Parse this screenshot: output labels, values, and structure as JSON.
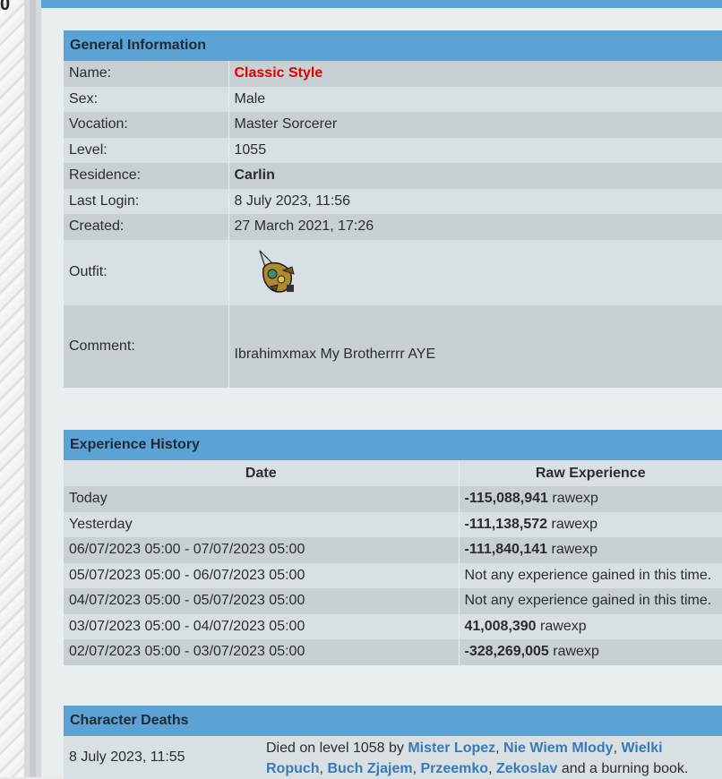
{
  "general": {
    "title": "General Information",
    "rows": [
      {
        "label": "Name:",
        "value": "Classic Style"
      },
      {
        "label": "Sex:",
        "value": "Male"
      },
      {
        "label": "Vocation:",
        "value": "Master Sorcerer"
      },
      {
        "label": "Level:",
        "value": "1055"
      },
      {
        "label": "Residence:",
        "value": "Carlin"
      },
      {
        "label": "Last Login:",
        "value": "8 July 2023, 11:56"
      },
      {
        "label": "Created:",
        "value": "27 March 2021, 17:26"
      }
    ],
    "outfit_label": "Outfit:",
    "comment_label": "Comment:",
    "comment_value": "Ibrahimxmax My Brotherrrr AYE"
  },
  "experience": {
    "title": "Experience History",
    "col_date": "Date",
    "col_exp": "Raw Experience",
    "rows": [
      {
        "date": "Today",
        "value": "-115,088,941",
        "unit": "rawexp"
      },
      {
        "date": "Yesterday",
        "value": "-111,138,572",
        "unit": "rawexp"
      },
      {
        "date": "06/07/2023 05:00 - 07/07/2023 05:00",
        "value": "-111,840,141",
        "unit": "rawexp"
      },
      {
        "date": "05/07/2023 05:00 - 06/07/2023 05:00",
        "note": "Not any experience gained in this time."
      },
      {
        "date": "04/07/2023 05:00 - 05/07/2023 05:00",
        "note": "Not any experience gained in this time."
      },
      {
        "date": "03/07/2023 05:00 - 04/07/2023 05:00",
        "value": "41,008,390",
        "unit": "rawexp"
      },
      {
        "date": "02/07/2023 05:00 - 03/07/2023 05:00",
        "value": "-328,269,005",
        "unit": "rawexp"
      }
    ]
  },
  "deaths": {
    "title": "Character Deaths",
    "rows": [
      {
        "date": "8 July 2023, 11:55",
        "prefix": "Died on level 1058 by",
        "killers": [
          "Mister Lopez",
          "Nie Wiem Mlody",
          "Wielki Ropuch",
          "Buch Zjajem",
          "Przeemko",
          "Zekoslav"
        ],
        "suffix": "and a burning book."
      }
    ]
  },
  "colors": {
    "header": "#5ba3d4",
    "row_dark": "#c8d0d4",
    "row_light": "#d9e0e3",
    "name_red": "#e00000",
    "link": "#3a79b8"
  }
}
